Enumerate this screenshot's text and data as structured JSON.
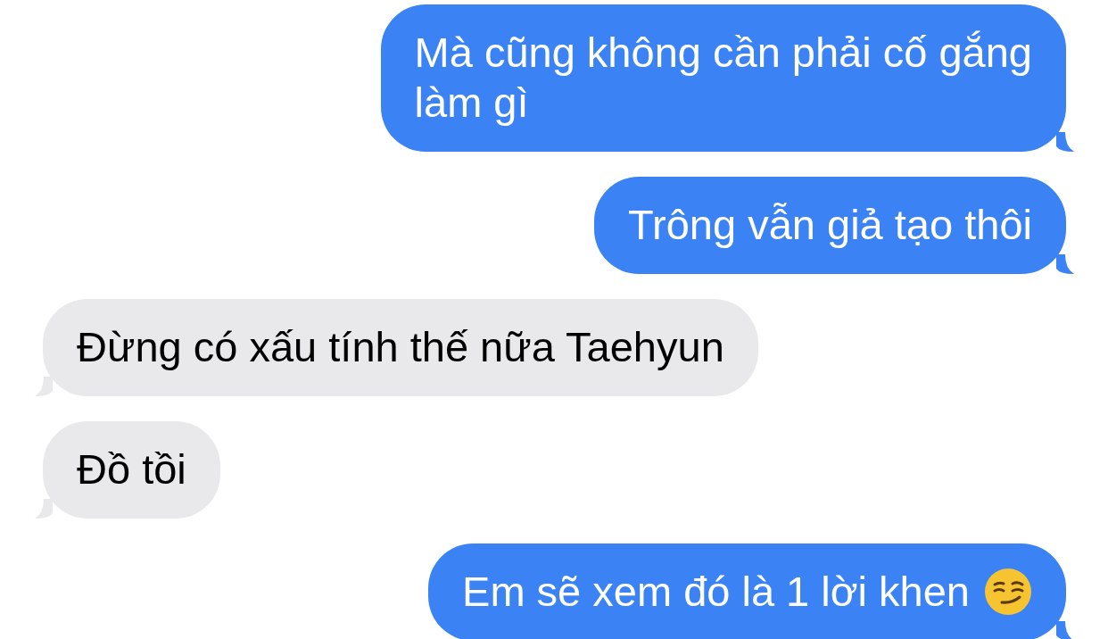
{
  "messages": [
    {
      "kind": "sent",
      "lines": [
        "Mà cũng không cần phải cố gắng",
        "làm gì"
      ]
    },
    {
      "kind": "sent",
      "lines": [
        "Trông vẫn giả tạo thôi"
      ]
    },
    {
      "kind": "received",
      "lines": [
        "Đừng có xấu tính thế nữa Taehyun"
      ]
    },
    {
      "kind": "received",
      "lines": [
        "Đồ tồi"
      ]
    },
    {
      "kind": "sent",
      "lines": [
        "Em sẽ xem đó là 1 lời khen"
      ],
      "trailing_emoji": true
    }
  ]
}
